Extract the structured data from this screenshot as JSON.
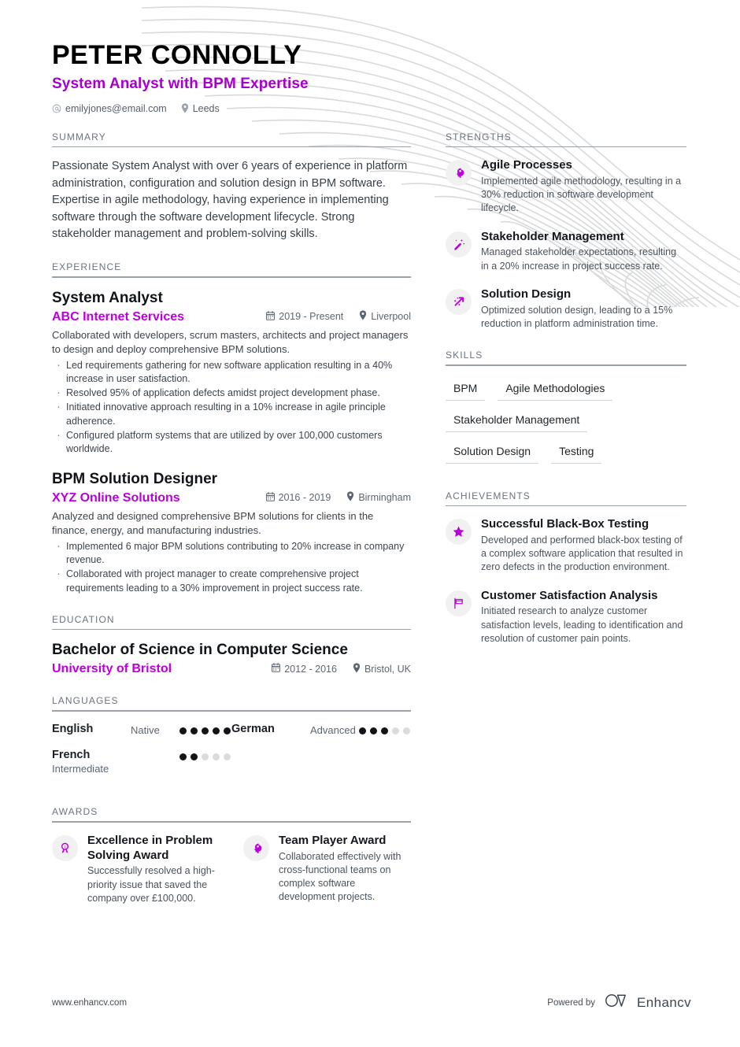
{
  "accent_color": "#bb00dd",
  "header": {
    "name": "PETER CONNOLLY",
    "headline": "System Analyst with BPM Expertise",
    "email": "emilyjones@email.com",
    "location": "Leeds"
  },
  "summary": {
    "title": "SUMMARY",
    "text": "Passionate System Analyst with over 6 years of experience in platform administration, configuration and solution design in BPM software. Expertise in agile methodology, having experience in implementing software through the software development lifecycle. Strong stakeholder management and problem-solving skills."
  },
  "experience": {
    "title": "EXPERIENCE",
    "entries": [
      {
        "role": "System Analyst",
        "company": "ABC Internet Services",
        "dates": "2019 - Present",
        "location": "Liverpool",
        "description": "Collaborated with developers, scrum masters, architects and project managers to design and deploy comprehensive BPM solutions.",
        "bullets": [
          "Led requirements gathering for new software application resulting in a 40% increase in user satisfaction.",
          "Resolved 95% of application defects amidst project development phase.",
          "Initiated innovative approach resulting in a 10% increase in agile principle adherence.",
          "Configured platform systems that are utilized by over 100,000 customers worldwide."
        ]
      },
      {
        "role": "BPM Solution Designer",
        "company": "XYZ Online Solutions",
        "dates": "2016 - 2019",
        "location": "Birmingham",
        "description": "Analyzed and designed comprehensive BPM solutions for clients in the finance, energy, and manufacturing industries.",
        "bullets": [
          "Implemented 6 major BPM solutions contributing to 20% increase in company revenue.",
          "Collaborated with project manager to create comprehensive project requirements leading to a 30% improvement in project success rate."
        ]
      }
    ]
  },
  "education": {
    "title": "EDUCATION",
    "entries": [
      {
        "degree": "Bachelor of Science in Computer Science",
        "school": "University of Bristol",
        "dates": "2012 - 2016",
        "location": "Bristol, UK"
      }
    ]
  },
  "languages": {
    "title": "LANGUAGES",
    "max_dots": 5,
    "items": [
      {
        "name": "English",
        "level": "Native",
        "dots": 5,
        "level_below": false
      },
      {
        "name": "German",
        "level": "Advanced",
        "dots": 3,
        "level_below": false
      },
      {
        "name": "French",
        "level": "Intermediate",
        "dots": 2,
        "level_below": true
      }
    ]
  },
  "awards": {
    "title": "AWARDS",
    "items": [
      {
        "icon": "medal-icon",
        "title": "Excellence in Problem Solving Award",
        "text": "Successfully resolved a high-priority issue that saved the company over £100,000."
      },
      {
        "icon": "brain-head-icon",
        "title": "Team Player Award",
        "text": "Collaborated effectively with cross-functional teams on complex software development projects."
      }
    ]
  },
  "strengths": {
    "title": "STRENGTHS",
    "items": [
      {
        "icon": "brain-head-icon",
        "title": "Agile Processes",
        "text": "Implemented agile methodology, resulting in a 30% reduction in software development lifecycle."
      },
      {
        "icon": "magic-wand-icon",
        "title": "Stakeholder Management",
        "text": "Managed stakeholder expectations, resulting in a 20% increase in project success rate."
      },
      {
        "icon": "arrow-trend-icon",
        "title": "Solution Design",
        "text": "Optimized solution design, leading to a 15% reduction in platform administration time."
      }
    ]
  },
  "skills": {
    "title": "SKILLS",
    "items": [
      "BPM",
      "Agile Methodologies",
      "Stakeholder Management",
      "Solution Design",
      "Testing"
    ]
  },
  "achievements": {
    "title": "ACHIEVEMENTS",
    "items": [
      {
        "icon": "star-icon",
        "title": "Successful Black-Box Testing",
        "text": "Developed and performed black-box testing of a complex software application that resulted in zero defects in the production environment."
      },
      {
        "icon": "flag-icon",
        "title": "Customer Satisfaction Analysis",
        "text": "Initiated research to analyze customer satisfaction levels, leading to identification and resolution of customer pain points."
      }
    ]
  },
  "footer": {
    "url": "www.enhancv.com",
    "powered_by": "Powered by",
    "brand": "Enhancv"
  }
}
